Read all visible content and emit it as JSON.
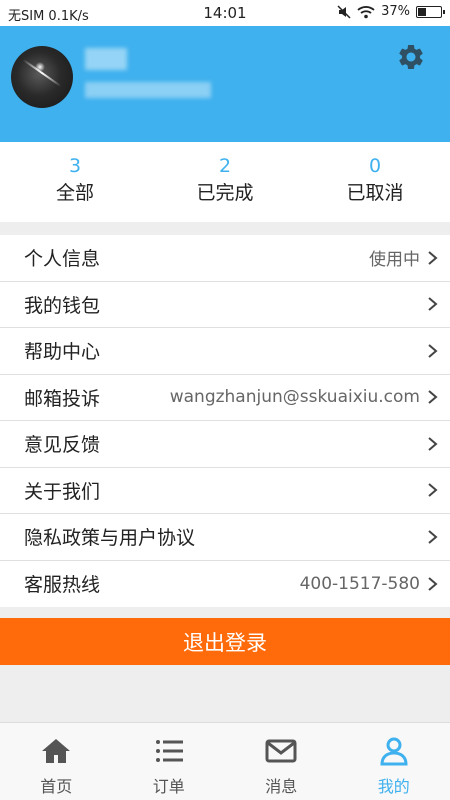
{
  "status_bar": {
    "carrier": "无SIM 0.1K/s",
    "time": "14:01",
    "battery": "37%",
    "battery_level": 0.37
  },
  "header": {
    "settings_icon": "gear-icon",
    "avatar": "avatar"
  },
  "stats": [
    {
      "count": "3",
      "label": "全部"
    },
    {
      "count": "2",
      "label": "已完成"
    },
    {
      "count": "0",
      "label": "已取消"
    }
  ],
  "menu": [
    {
      "label": "个人信息",
      "value": "使用中"
    },
    {
      "label": "我的钱包",
      "value": ""
    },
    {
      "label": "帮助中心",
      "value": ""
    },
    {
      "label": "邮箱投诉",
      "value": "wangzhanjun@sskuaixiu.com"
    },
    {
      "label": "意见反馈",
      "value": ""
    },
    {
      "label": "关于我们",
      "value": ""
    },
    {
      "label": "隐私政策与用户协议",
      "value": ""
    },
    {
      "label": "客服热线",
      "value": "400-1517-580"
    }
  ],
  "logout_label": "退出登录",
  "tabs": [
    {
      "label": "首页",
      "icon": "home-icon",
      "active": false
    },
    {
      "label": "订单",
      "icon": "list-icon",
      "active": false
    },
    {
      "label": "消息",
      "icon": "mail-icon",
      "active": false
    },
    {
      "label": "我的",
      "icon": "user-icon",
      "active": true
    }
  ],
  "colors": {
    "accent": "#3fb1ee",
    "logout": "#ff6a0a",
    "inactive_icon": "#555555"
  }
}
